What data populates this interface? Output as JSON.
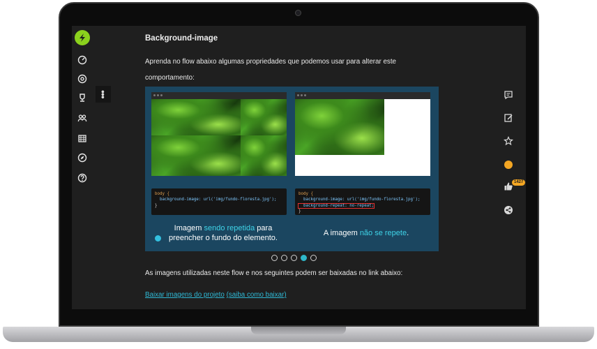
{
  "lesson": {
    "title": "Background-image",
    "intro": "Aprenda no flow abaixo algumas propriedades que podemos usar para alterar este comportamento:",
    "after_slide": "As imagens utilizadas neste flow e nos seguintes podem ser baixadas no link abaixo:",
    "link_download": "Baixar imagens do projeto",
    "link_howto": "(saiba como baixar)"
  },
  "slide": {
    "left_code": [
      "body {",
      "  background-image: url('img/fundo-floresta.jpg');",
      "}"
    ],
    "right_code": [
      "body {",
      "  background-image: url('img/fundo-floresta.jpg');",
      "  background-repeat: no-repeat;",
      "}"
    ],
    "left_caption": {
      "pre": "Imagem ",
      "accent": "sendo repetida",
      "post": " para",
      "line2": "preencher o fundo do elemento."
    },
    "right_caption": {
      "pre": "A imagem ",
      "accent": "não se repete",
      "post": "."
    }
  },
  "pager": {
    "count": 5,
    "active_index": 3
  },
  "likes_badge": "1427",
  "colors": {
    "accent": "#2fb9d6",
    "brand": "#8bd11d",
    "coin": "#f3a623",
    "slide_bg": "#1b4660"
  },
  "icons": {
    "left_rail": [
      "logo-icon",
      "dashboard-icon",
      "support-icon",
      "trophy-icon",
      "community-icon",
      "calendar-icon",
      "compass-icon",
      "help-icon"
    ],
    "right_rail": [
      "comment-icon",
      "notes-icon",
      "star-icon",
      "coin-icon",
      "thumbs-up-icon",
      "share-icon"
    ]
  }
}
